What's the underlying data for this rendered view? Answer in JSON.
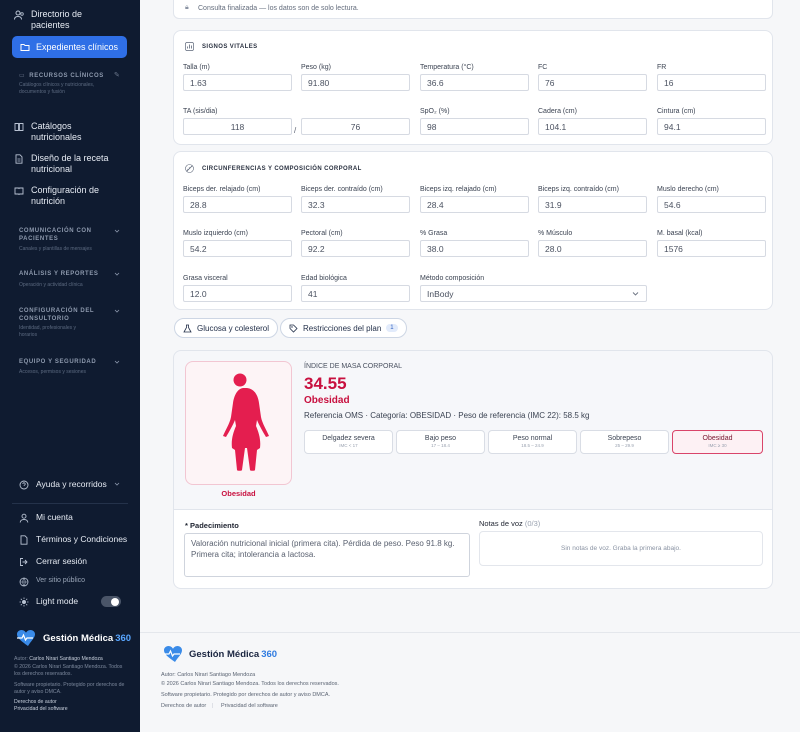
{
  "sidebar": {
    "top_items": [
      {
        "label": "Directorio de pacientes",
        "icon": "users-icon"
      },
      {
        "label": "Expedientes clínicos",
        "icon": "folder-icon"
      }
    ],
    "sections": [
      {
        "title": "RECURSOS CLÍNICOS",
        "subtitle": "Catálogos clínicos y nutricionales, documentos y fusión"
      },
      {
        "title": "COMUNICACIÓN CON PACIENTES",
        "subtitle": "Canales y plantillas de mensajes"
      },
      {
        "title": "ANÁLISIS Y REPORTES",
        "subtitle": "Operación y actividad clínica"
      },
      {
        "title": "CONFIGURACIÓN DEL CONSULTORIO",
        "subtitle": "Identidad, profesionales y horarios"
      },
      {
        "title": "EQUIPO Y SEGURIDAD",
        "subtitle": "Accesos, permisos y sesiones"
      }
    ],
    "resource_items": [
      "Catálogos nutricionales",
      "Diseño de la receta nutricional",
      "Configuración de nutrición"
    ],
    "bottom_items": {
      "help": "Ayuda y recorridos",
      "account": "Mi cuenta",
      "terms": "Términos y Condiciones",
      "logout": "Cerrar sesión",
      "public_site": "Ver sitio público",
      "light_mode": "Light mode"
    },
    "brand": {
      "name": "Gestión Médica",
      "number": "360"
    },
    "footer": {
      "author_label": "Autor:",
      "author_name": "Carlos Nirari Santiago Mendoza",
      "copyright": "© 2026 Carlos Nirari Santiago Mendoza. Todos los derechos reservados.",
      "license": "Software propietario. Protegido por derechos de autor y aviso DMCA.",
      "link1": "Derechos de autor",
      "link2": "Privacidad del software"
    }
  },
  "readonly_notice": "Consulta finalizada — los datos son de solo lectura.",
  "vitals": {
    "title": "SIGNOS VITALES",
    "fields": [
      {
        "label": "Talla (m)",
        "value": "1.63"
      },
      {
        "label": "Peso (kg)",
        "value": "91.80"
      },
      {
        "label": "Temperatura (°C)",
        "value": "36.6"
      },
      {
        "label": "FC",
        "value": "76"
      },
      {
        "label": "FR",
        "value": "16"
      },
      {
        "label": "TA (sis/dia)",
        "value": "118"
      },
      {
        "label": "",
        "value": "76"
      },
      {
        "label": "SpO₂ (%)",
        "value": "98"
      },
      {
        "label": "Cadera (cm)",
        "value": "104.1"
      },
      {
        "label": "Cintura (cm)",
        "value": "94.1"
      }
    ],
    "ta_separator": "/"
  },
  "body": {
    "title": "CIRCUNFERENCIAS Y COMPOSICIÓN CORPORAL",
    "fields": [
      {
        "label": "Biceps der. relajado (cm)",
        "value": "28.8"
      },
      {
        "label": "Biceps der. contraído (cm)",
        "value": "32.3"
      },
      {
        "label": "Biceps izq. relajado (cm)",
        "value": "28.4"
      },
      {
        "label": "Biceps izq. contraído (cm)",
        "value": "31.9"
      },
      {
        "label": "Muslo derecho (cm)",
        "value": "54.6"
      },
      {
        "label": "Muslo izquierdo (cm)",
        "value": "54.2"
      },
      {
        "label": "Pectoral (cm)",
        "value": "92.2"
      },
      {
        "label": "% Grasa",
        "value": "38.0"
      },
      {
        "label": "% Músculo",
        "value": "28.0"
      },
      {
        "label": "M. basal (kcal)",
        "value": "1576"
      },
      {
        "label": "Grasa visceral",
        "value": "12.0"
      },
      {
        "label": "Edad biológica",
        "value": "41"
      }
    ],
    "method": {
      "label": "Método composición",
      "value": "InBody"
    }
  },
  "pills": {
    "glucose": "Glucosa y colesterol",
    "restrictions": "Restricciones del plan",
    "restrictions_count": "1"
  },
  "imc": {
    "heading": "ÍNDICE DE MASA CORPORAL",
    "value": "34.55",
    "category": "Obesidad",
    "figure_label": "Obesidad",
    "reference": "Referencia OMS · Categoría: OBESIDAD · Peso de referencia (IMC 22): 58.5 kg",
    "scale": [
      {
        "label": "Delgadez severa",
        "range": "IMC < 17"
      },
      {
        "label": "Bajo peso",
        "range": "17 – 18.4"
      },
      {
        "label": "Peso normal",
        "range": "18.5 – 24.9"
      },
      {
        "label": "Sobrepeso",
        "range": "25 – 29.9"
      },
      {
        "label": "Obesidad",
        "range": "IMC ≥ 30"
      }
    ],
    "accent": "#c8103f"
  },
  "notes": {
    "required_mark": "*",
    "label": "Padecimiento",
    "text": "Valoración nutricional inicial (primera cita). Pérdida de peso. Peso 91.8 kg. Primera cita; intolerancia a lactosa.",
    "voice_label": "Notas de voz",
    "voice_count": "(0/3)",
    "voice_empty": "Sin notas de voz. Graba la primera abajo."
  },
  "footer": {
    "brand": "Gestión Médica",
    "brand_number": "360",
    "author": "Autor: Carlos Nirari Santiago Mendoza",
    "copyright": "© 2026 Carlos Nirari Santiago Mendoza. Todos los derechos reservados.",
    "license": "Software propietario. Protegido por derechos de autor y aviso DMCA.",
    "link1": "Derechos de autor",
    "link2": "Privacidad del software"
  }
}
